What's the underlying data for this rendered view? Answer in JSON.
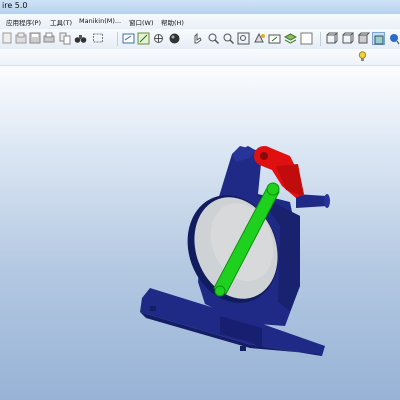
{
  "window": {
    "title": "ire 5.0"
  },
  "menu": {
    "items": [
      {
        "label": "应用程序(P)"
      },
      {
        "label": "工具(T)"
      },
      {
        "label": "Manikin(M)..."
      },
      {
        "label": "窗口(W)"
      },
      {
        "label": "帮助(H)"
      }
    ]
  },
  "toolbar": {
    "icons": [
      "new-icon",
      "open-icon",
      "save-icon",
      "print-icon",
      "copy-icon",
      "binoculars-icon",
      "select-box-icon",
      "repaint-icon",
      "spin-center-icon",
      "datum-display-icon",
      "shading-icon",
      "orient-icon",
      "zoom-in-icon",
      "zoom-out-icon",
      "refit-icon",
      "reorient-icon",
      "saved-views-icon",
      "layers-icon",
      "wireframe-icon",
      "hidden-line-icon",
      "no-hidden-icon",
      "shaded-icon",
      "enhanced-realism-icon",
      "model-tree-icon"
    ]
  },
  "colors": {
    "base_body": "#1f2a86",
    "wheel": "#cfd2d4",
    "crank_arm": "#1fd11f",
    "link": "#e01010",
    "viewport_top": "#fbfcfe",
    "viewport_bottom": "#98b3d6"
  }
}
